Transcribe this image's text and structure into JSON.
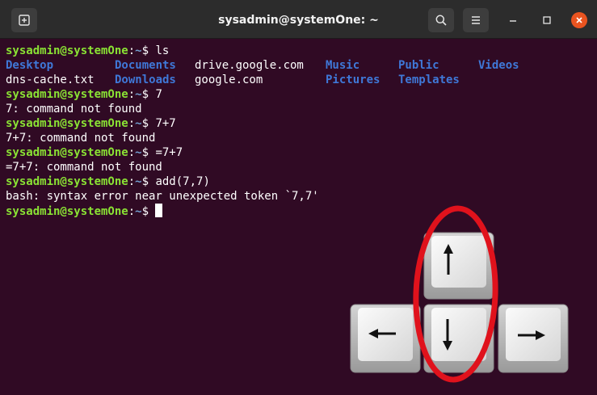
{
  "window": {
    "title": "sysadmin@systemOne: ~"
  },
  "prompt": {
    "user_host": "sysadmin@systemOne",
    "sep": ":",
    "path": "~",
    "symbol": "$ "
  },
  "session": {
    "cmd_ls": "ls",
    "ls_row1": [
      "Desktop",
      "Documents",
      "drive.google.com",
      "Music",
      "Public",
      "Videos"
    ],
    "ls_row2": [
      "dns-cache.txt",
      "Downloads",
      "google.com",
      "Pictures",
      "Templates"
    ],
    "cmd_2": "7",
    "out_2": "7: command not found",
    "cmd_3": "7+7",
    "out_3": "7+7: command not found",
    "cmd_4": "=7+7",
    "out_4": "=7+7: command not found",
    "cmd_5": "add(7,7)",
    "out_5": "bash: syntax error near unexpected token `7,7'"
  },
  "overlay": {
    "keys": [
      "up-arrow-key",
      "left-arrow-key",
      "down-arrow-key",
      "right-arrow-key"
    ],
    "highlight_color": "#e0121c"
  },
  "colors": {
    "background": "#300a24",
    "prompt_user": "#8ae234",
    "prompt_path": "#729fcf",
    "directory": "#3f78d8",
    "close_button": "#e95420"
  }
}
